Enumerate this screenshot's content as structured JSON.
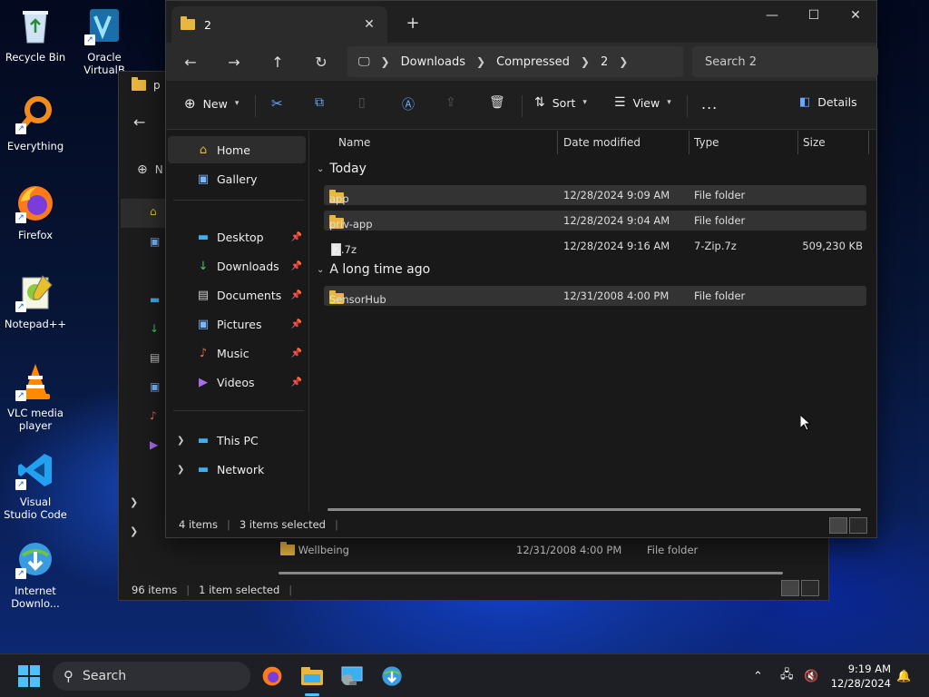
{
  "desktop": {
    "icons": [
      {
        "label": "Recycle Bin"
      },
      {
        "label": "Oracle VirtualB"
      },
      {
        "label": "Everything"
      },
      {
        "label": "Firefox"
      },
      {
        "label": "Notepad++"
      },
      {
        "label": "VLC media player"
      },
      {
        "label": "Visual Studio Code"
      },
      {
        "label": "Internet Downlo..."
      }
    ]
  },
  "back_window": {
    "title": "p",
    "nav_label": "N",
    "row": {
      "name": "Wellbeing",
      "date": "12/31/2008 4:00 PM",
      "type": "File folder"
    },
    "status": {
      "items": "96 items",
      "selected": "1 item selected"
    }
  },
  "window": {
    "tab_title": "2",
    "search_placeholder": "Search 2",
    "breadcrumbs": [
      "Downloads",
      "Compressed",
      "2"
    ],
    "toolbar": {
      "new": "New",
      "sort": "Sort",
      "view": "View",
      "more": "...",
      "details": "Details"
    },
    "nav": {
      "home": "Home",
      "gallery": "Gallery",
      "desktop": "Desktop",
      "downloads": "Downloads",
      "documents": "Documents",
      "pictures": "Pictures",
      "music": "Music",
      "videos": "Videos",
      "this_pc": "This PC",
      "network": "Network"
    },
    "columns": {
      "name": "Name",
      "date": "Date modified",
      "type": "Type",
      "size": "Size"
    },
    "groups": [
      {
        "label": "Today",
        "rows": [
          {
            "name": "app",
            "date": "12/28/2024 9:09 AM",
            "type": "File folder",
            "size": ""
          },
          {
            "name": "priv-app",
            "date": "12/28/2024 9:04 AM",
            "type": "File folder",
            "size": ""
          },
          {
            "name": "2.7z",
            "date": "12/28/2024 9:16 AM",
            "type": "7-Zip.7z",
            "size": "509,230 KB"
          }
        ]
      },
      {
        "label": "A long time ago",
        "rows": [
          {
            "name": "SensorHub",
            "date": "12/31/2008 4:00 PM",
            "type": "File folder",
            "size": ""
          }
        ]
      }
    ],
    "status": {
      "items": "4 items",
      "selected": "3 items selected"
    }
  },
  "taskbar": {
    "search_label": "Search",
    "time": "9:19 AM",
    "date": "12/28/2024"
  },
  "colors": {
    "accent": "#4cc2ff",
    "folder": "#e9b73f",
    "window_bg": "#191919"
  }
}
